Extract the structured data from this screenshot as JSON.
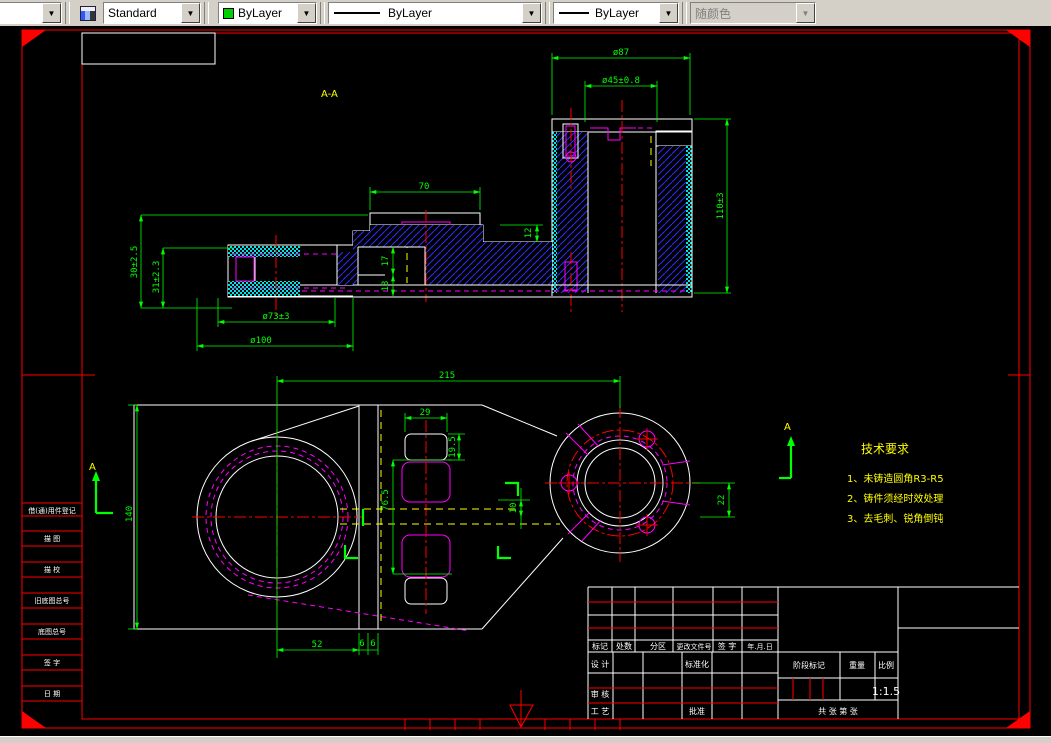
{
  "toolbar": {
    "style_combo": "Standard",
    "color_combo": "ByLayer",
    "linetype_combo": "ByLayer",
    "lineweight_combo": "ByLayer",
    "plotstyle_combo": "随颜色"
  },
  "colors": {
    "dimension": "#00ff00",
    "frame": "#ff0000",
    "outline": "#ffffff",
    "hidden": "#ff00ff",
    "section_plane": "#ffff00",
    "hatch": "#2e2eff",
    "cast_skin": "#00ffff"
  },
  "drawing": {
    "section_title": "A-A",
    "section_arrow_left": "A",
    "section_arrow_right": "A",
    "tech": {
      "title": "技术要求",
      "item1": "1、未铸造圆角R3-R5",
      "item2": "2、铸件须经时效处理",
      "item3": "3、去毛刺、锐角倒钝"
    },
    "dims": {
      "d87": "ø87",
      "d45": "ø45±0.8",
      "d70": "70",
      "d12": "12",
      "d110": "110±3",
      "d30": "30±2.5",
      "d31": "31±2.3",
      "d17": "17",
      "d13": "13",
      "d73": "ø73±3",
      "d100": "ø100",
      "d215": "215",
      "d140": "140",
      "d29": "29",
      "d195": "19.5",
      "d765": "76.5",
      "d10": "10",
      "d22": "22",
      "d52": "52",
      "d6a": "6",
      "d6b": "6"
    }
  },
  "title_block": {
    "header": [
      "标记",
      "处数",
      "分区",
      "更改文件号",
      "签 字",
      "年.月.日"
    ],
    "design": "设 计",
    "standardization": "标准化",
    "audit": "审 核",
    "process": "工 艺",
    "approve": "批准",
    "stage_mark": "阶段标记",
    "weight": "重量",
    "scale_label": "比例",
    "scale_value": "1:1.5",
    "sheets": "共  张 第  张"
  },
  "side_column": [
    "借(通)用件登记",
    "描 图",
    "描 校",
    "旧底图总号",
    "底图总号",
    "签 字",
    "日 期"
  ]
}
